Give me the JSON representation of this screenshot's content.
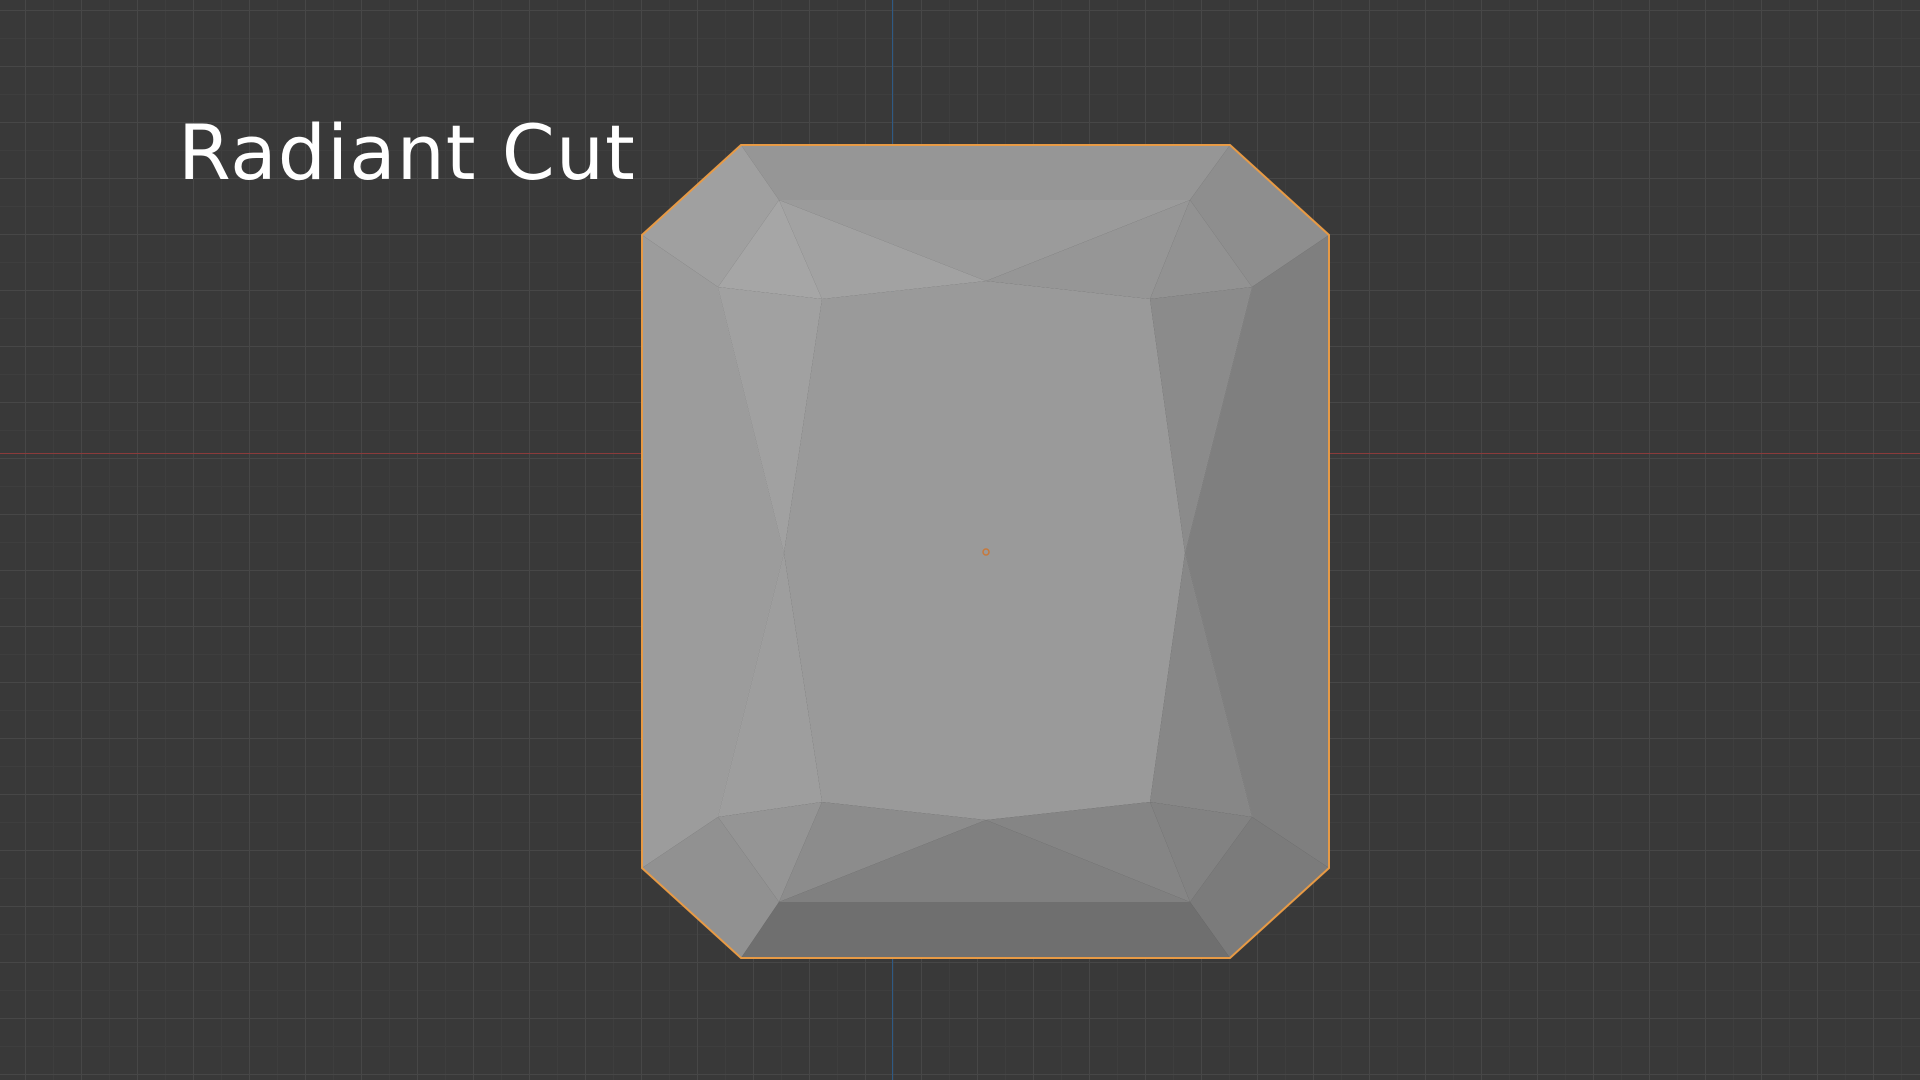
{
  "title": "Radiant Cut",
  "colors": {
    "background": "#393939",
    "grid_major": "#474747",
    "grid_minor": "#3e3e3e",
    "x_axis": "#8a3b3b",
    "y_axis": "#2e5a85",
    "selection_outline": "#e79a45",
    "origin_dot": "#c8783a"
  }
}
